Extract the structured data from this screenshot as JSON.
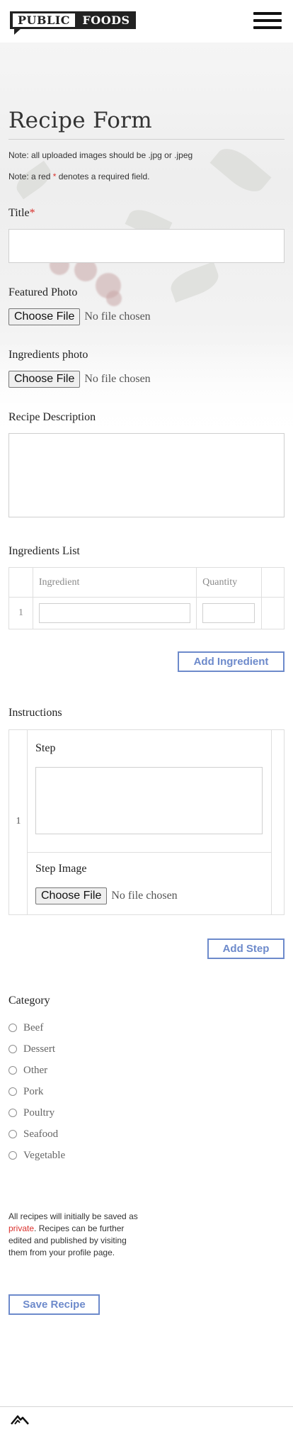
{
  "header": {
    "logo": {
      "word1": "PUBLIC",
      "word2": "FOODS"
    },
    "menu_icon": "hamburger-menu-icon"
  },
  "form": {
    "title": "Recipe Form",
    "note_images": "Note: all uploaded images should be .jpg or .jpeg",
    "note_required_prefix": "Note: a red ",
    "note_required_star": "*",
    "note_required_suffix": " denotes a required field.",
    "title_field": {
      "label": "Title",
      "required_marker": "*",
      "value": ""
    },
    "featured_photo": {
      "label": "Featured Photo",
      "button": "Choose File",
      "status": "No file chosen"
    },
    "ingredients_photo": {
      "label": "Ingredients photo",
      "button": "Choose File",
      "status": "No file chosen"
    },
    "description": {
      "label": "Recipe Description",
      "value": ""
    },
    "ingredients": {
      "label": "Ingredients List",
      "columns": [
        "Ingredient",
        "Quantity"
      ],
      "rows": [
        {
          "num": "1",
          "ingredient": "",
          "quantity": ""
        }
      ],
      "add_button": "Add Ingredient"
    },
    "instructions": {
      "label": "Instructions",
      "steps": [
        {
          "num": "1",
          "step_label": "Step",
          "value": "",
          "image_label": "Step Image",
          "button": "Choose File",
          "status": "No file chosen"
        }
      ],
      "add_button": "Add Step"
    },
    "category": {
      "label": "Category",
      "options": [
        "Beef",
        "Dessert",
        "Other",
        "Pork",
        "Poultry",
        "Seafood",
        "Vegetable"
      ]
    },
    "info": {
      "before": "All recipes will initially be saved as ",
      "highlight": "private",
      "after": ". Recipes can be further edited and published by visiting them from your profile page."
    },
    "save_button": "Save Recipe"
  },
  "footer": {
    "icon": "mountain-logo-icon"
  },
  "colors": {
    "required_red": "#d9302c",
    "button_blue": "#6d8acb",
    "border_gray": "#cfcfcf"
  }
}
